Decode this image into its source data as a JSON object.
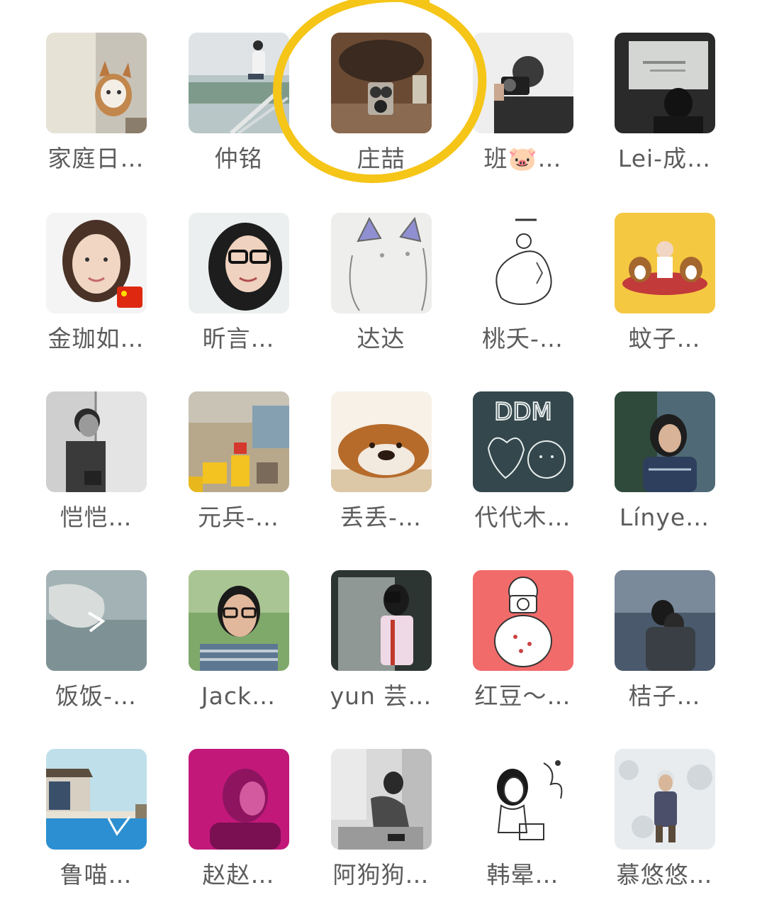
{
  "contacts": [
    {
      "name": "家庭日…",
      "avatar": "cat-photo"
    },
    {
      "name": "仲铭",
      "avatar": "person-on-railing"
    },
    {
      "name": "庄喆",
      "avatar": "vintage-camera"
    },
    {
      "name": "班🐷…",
      "avatar": "man-with-camera"
    },
    {
      "name": "Lei-成…",
      "avatar": "presentation-silhouette"
    },
    {
      "name": "金珈如…",
      "avatar": "woman-portrait-with-flag"
    },
    {
      "name": "昕言…",
      "avatar": "woman-with-glasses"
    },
    {
      "name": "达达",
      "avatar": "cat-drawing"
    },
    {
      "name": "桃夭-…",
      "avatar": "mermaid-sketch"
    },
    {
      "name": "蚊子…",
      "avatar": "dogs-illustration"
    },
    {
      "name": "恺恺…",
      "avatar": "man-at-window"
    },
    {
      "name": "元兵-…",
      "avatar": "cafe-yellow-stools"
    },
    {
      "name": "丢丢-…",
      "avatar": "bulldog"
    },
    {
      "name": "代代木…",
      "avatar": "chalkboard-ddm"
    },
    {
      "name": "Línye…",
      "avatar": "woman-outdoors"
    },
    {
      "name": "饭饭-…",
      "avatar": "cloud-mist"
    },
    {
      "name": "Jack…",
      "avatar": "man-with-glasses"
    },
    {
      "name": "yun 芸…",
      "avatar": "woman-mirror-camera"
    },
    {
      "name": "红豆～…",
      "avatar": "photographer-cartoon"
    },
    {
      "name": "桔子…",
      "avatar": "couple-by-sea"
    },
    {
      "name": "鲁喵…",
      "avatar": "pool-painting"
    },
    {
      "name": "赵赵…",
      "avatar": "magenta-portrait"
    },
    {
      "name": "阿狗狗…",
      "avatar": "woman-sitting-bw"
    },
    {
      "name": "韩晕…",
      "avatar": "girl-music-sketch"
    },
    {
      "name": "慕悠悠…",
      "avatar": "person-in-snow"
    }
  ],
  "highlight": {
    "target_index": 2,
    "color": "#F5C518"
  }
}
